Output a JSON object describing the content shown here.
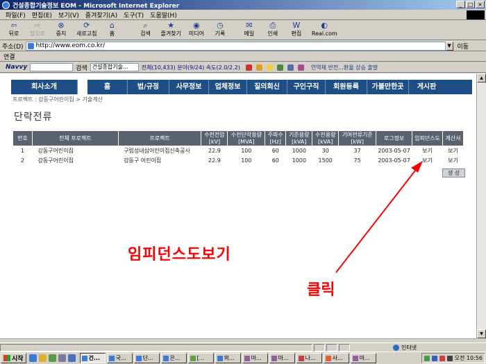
{
  "window": {
    "title": "건설종합기술정보 EOM - Microsoft Internet Explorer",
    "buttons": [
      "_",
      "□",
      "×"
    ]
  },
  "menu": [
    "파일(F)",
    "편집(E)",
    "보기(V)",
    "즐겨찾기(A)",
    "도구(T)",
    "도움말(H)"
  ],
  "toolbar": {
    "back": "뒤로",
    "forward": "앞으로",
    "stop": "중지",
    "refresh": "새로고침",
    "home": "홈",
    "search": "검색",
    "favorites": "즐겨찾기",
    "media": "미디어",
    "history": "기록",
    "mail": "메일",
    "print": "인쇄",
    "edit": "편집",
    "real": "Real.com"
  },
  "address": {
    "label": "주소(D)",
    "url": "http://www.eom.co.kr/",
    "go": "이동"
  },
  "links": {
    "label": "연결"
  },
  "searchbar": {
    "brand": "Navvy",
    "search_btn": "검색",
    "box_value": "건설종합기술...",
    "counts": "전체(10,433) 분야(9/24) 속도(2.0/2.2)",
    "ticker": "연약체 반전...환율 상승 출발"
  },
  "site_nav": [
    "회사소개",
    "홈",
    "법/규정",
    "사무정보",
    "업체정보",
    "질의회신",
    "구인구직",
    "회원등록",
    "가볼만한곳",
    "게시판"
  ],
  "breadcrumb": "프로젝트 : 강동구어린이집 > 기술계산",
  "page_title": "단락전류",
  "table": {
    "headers": [
      [
        "번호"
      ],
      [
        "전체 프로젝트"
      ],
      [
        "프로젝트"
      ],
      [
        "수전전압",
        "[kV]"
      ],
      [
        "수전단락용량",
        "[MVA]"
      ],
      [
        "주파수",
        "[Hz]"
      ],
      [
        "기준용량",
        "[kVA]"
      ],
      [
        "수전용량",
        "[kVA]"
      ],
      [
        "기여전류기준",
        "[kW]"
      ],
      [
        "로그정보"
      ],
      [
        "임피던스도"
      ],
      [
        "계산서"
      ]
    ],
    "rows": [
      [
        "1",
        "강동구어린이집",
        "구립성내삼어린이집신축공사",
        "22.9",
        "100",
        "60",
        "1000",
        "30",
        "37",
        "2003-05-07",
        "보기",
        "보기"
      ],
      [
        "2",
        "강동구어린이집",
        "강동구 어린이집",
        "22.9",
        "100",
        "60",
        "1000",
        "1500",
        "75",
        "2003-05-07",
        "보기",
        "보기"
      ]
    ],
    "create_button": "생 성"
  },
  "annotations": {
    "label": "임피던스도보기",
    "click": "클릭",
    "color": "#ff0000"
  },
  "status": {
    "zone": "인터넷"
  },
  "taskbar": {
    "start": "시작",
    "tasks": [
      "건...",
      "국...",
      "단...",
      "은...",
      "[...",
      "외...",
      "마...",
      "마...",
      "나...",
      "사...",
      "마..."
    ],
    "clock": "오전 10:56"
  }
}
